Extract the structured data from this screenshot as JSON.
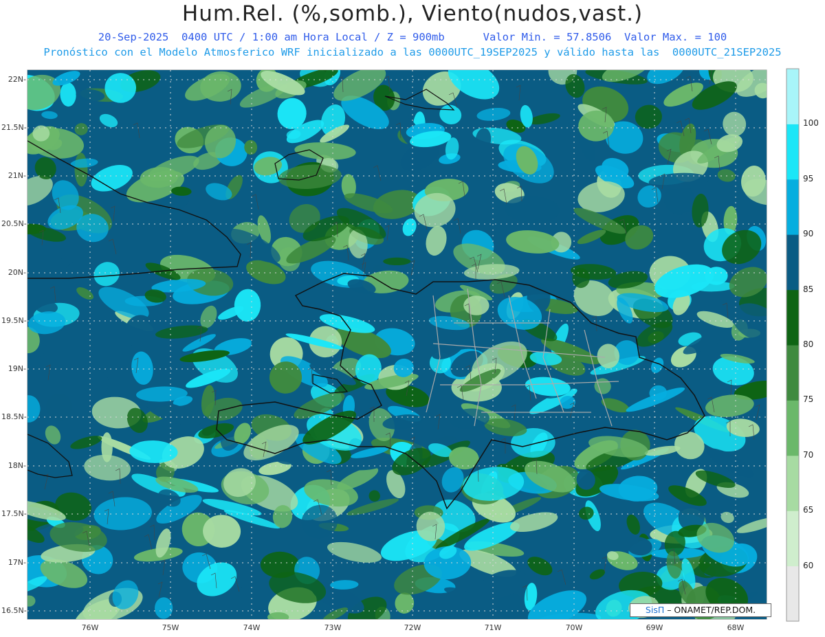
{
  "title": "Hum.Rel. (%,somb.), Viento(nudos,vast.)",
  "subtitle_line1": "20-Sep-2025  0400 UTC / 1:00 am Hora Local / Z = 900mb      Valor Min. = 57.8506  Valor Max. = 100",
  "subtitle_line2": "Pronóstico con el Modelo Atmosferico WRF inicializado a las 0000UTC_19SEP2025 y válido hasta las  0000UTC_21SEP2025",
  "lat_labels": [
    "22N",
    "21.5N",
    "21N",
    "20.5N",
    "20N",
    "19.5N",
    "19N",
    "18.5N",
    "18N",
    "17.5N",
    "17N",
    "16.5N"
  ],
  "lon_labels": [
    "76W",
    "75W",
    "74W",
    "73W",
    "72W",
    "71W",
    "70W",
    "69W",
    "68W"
  ],
  "colorbar": {
    "labels": [
      "60",
      "65",
      "70",
      "75",
      "80",
      "85",
      "90",
      "95",
      "100"
    ],
    "colors": [
      "#e8e8e8",
      "#cfeecd",
      "#a7dba2",
      "#6bb86a",
      "#3f8a3f",
      "#0e6414",
      "#0a5c84",
      "#06aedf",
      "#1be6f7",
      "#a8f5f9"
    ]
  },
  "credit": {
    "brand": "SisΠ",
    "text": " – ONAMET/REP.DOM."
  }
}
